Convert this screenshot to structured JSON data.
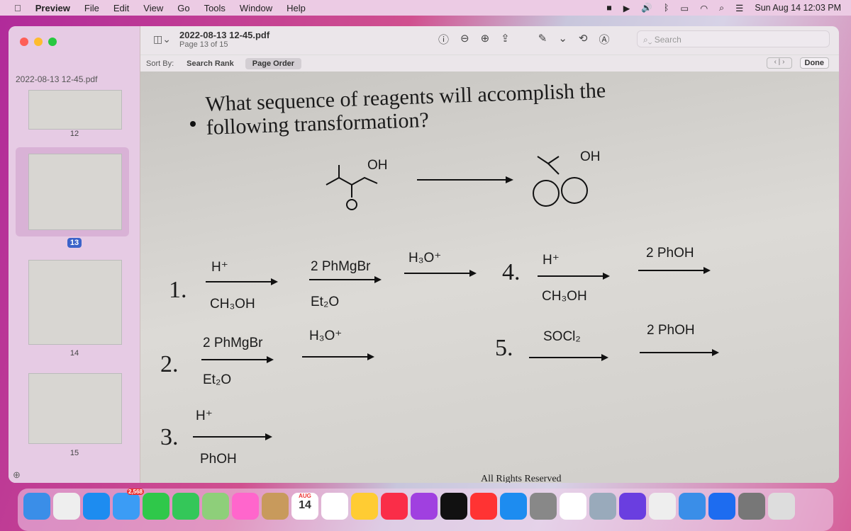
{
  "menubar": {
    "app": "Preview",
    "items": [
      "File",
      "Edit",
      "View",
      "Go",
      "Tools",
      "Window",
      "Help"
    ],
    "clock": "Sun Aug 14  12:03 PM"
  },
  "window": {
    "title": "2022-08-13 12-45.pdf",
    "subtitle": "Page 13 of 15",
    "search_placeholder": "Search"
  },
  "sortbar": {
    "label": "Sort By:",
    "options": [
      "Search Rank",
      "Page Order"
    ],
    "selected": "Page Order",
    "done": "Done"
  },
  "sidebar": {
    "title": "2022-08-13 12-45.pdf",
    "pages": [
      "12",
      "13",
      "14",
      "15"
    ],
    "selected": "13"
  },
  "document": {
    "question": "What sequence of reagents will accomplish the following transformation?",
    "reactant_label": "OH",
    "product_label": "OH",
    "options": [
      {
        "num": "1.",
        "steps": [
          {
            "above": "H⁺",
            "below": "CH₃OH"
          },
          {
            "above": "2 PhMgBr",
            "below": "Et₂O"
          },
          {
            "above": "H₃O⁺",
            "below": ""
          }
        ]
      },
      {
        "num": "2.",
        "steps": [
          {
            "above": "2 PhMgBr",
            "below": "Et₂O"
          },
          {
            "above": "H₃O⁺",
            "below": ""
          }
        ]
      },
      {
        "num": "3.",
        "steps": [
          {
            "above": "H⁺",
            "below": "PhOH"
          }
        ]
      },
      {
        "num": "4.",
        "steps": [
          {
            "above": "H⁺",
            "below": "CH₃OH"
          },
          {
            "above": "2 PhOH",
            "below": ""
          }
        ]
      },
      {
        "num": "5.",
        "steps": [
          {
            "above": "SOCl₂",
            "below": ""
          },
          {
            "above": "2 PhOH",
            "below": ""
          }
        ]
      }
    ],
    "footer": "All Rights Reserved"
  },
  "dock": {
    "mail_badge": "2,568",
    "calendar_month": "AUG",
    "calendar_day": "14"
  }
}
